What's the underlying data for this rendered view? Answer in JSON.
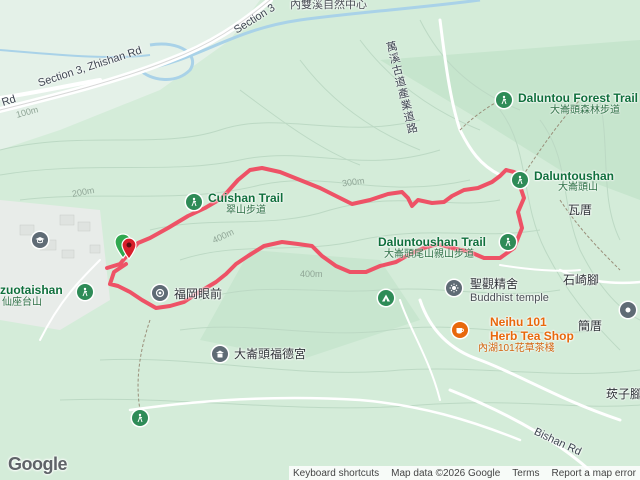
{
  "labels": {
    "section3_top": "Section 3",
    "neishuangxi": "內雙溪自然中心",
    "road_left": "Rd",
    "zhishan": "Section 3, Zhishan Rd",
    "wanxi": "萬溪古道產業道路",
    "daluntou_forest_en": "Daluntou Forest Trail",
    "daluntou_forest_zh": "大崙頭森林步道",
    "daluntoushan_en": "Daluntoushan",
    "daluntoushan_zh": "大崙頭山",
    "cuishan_en": "Cuishan Trail",
    "cuishan_zh": "翠山步道",
    "waliao": "瓦厝",
    "daluntoushan_trail_en": "Daluntoushan Trail",
    "daluntoushan_trail_zh": "大崙頭尾山親山步道",
    "shengguan": "聖觀精舍",
    "buddhist": "Buddhist temple",
    "shiqijiao": "石崎腳",
    "zuotaishan_en": "zuotaishan",
    "zuotaishan_zh": "仙座台山",
    "fugang": "福岡眼前",
    "jianliao": "簡厝",
    "neihu_en1": "Neihu 101",
    "neihu_en2": "Herb Tea Shop",
    "neihu_zh": "內湖101花草茶棧",
    "fudegong": "大崙頭福德宮",
    "zhuziliao": "莰子腳",
    "bishan": "Bishan Rd",
    "c100": "100m",
    "c200": "200m",
    "c300": "300m",
    "c400a": "400m",
    "c400b": "400m"
  },
  "footer": {
    "google": "Google",
    "shortcuts": "Keyboard shortcuts",
    "mapdata": "Map data ©2026 Google",
    "terms": "Terms",
    "report": "Report a map error"
  },
  "icons": {
    "trail": "hiker-icon",
    "viewpoint": "viewpoint-icon",
    "temple": "temple-icon",
    "campground": "campground-icon",
    "cafe": "cafe-icon",
    "start_pin": "location-pin-icon"
  },
  "colors": {
    "route": "#ee5266",
    "terrain": "#d4ecd9",
    "road": "#ffffff",
    "water": "#a9d2e8",
    "trail_pin": "#2e8b57",
    "place_pin": "#5f6b75",
    "cafe_pin": "#e8680c"
  }
}
